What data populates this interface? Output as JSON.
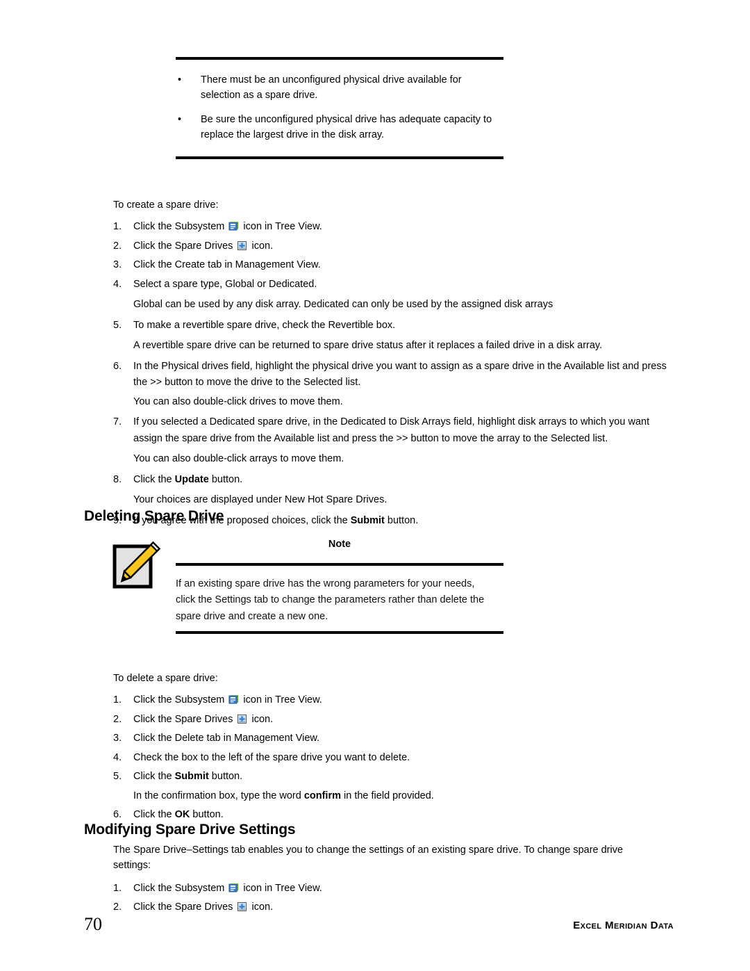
{
  "document": {
    "page_number": "70",
    "publisher": "Excel Meridian Data"
  },
  "top_callout": {
    "bullets": [
      "There must be an unconfigured physical drive available for selection as a spare drive.",
      "Be sure the unconfigured physical drive has adequate capacity to replace the largest drive in the disk array."
    ],
    "bullet_mark": "•"
  },
  "create_procedure": {
    "intro": "To create a spare drive:",
    "steps": [
      {
        "num": "1.",
        "pre": "Click the Subsystem ",
        "icon": "subsystem-icon",
        "post": " icon in Tree View."
      },
      {
        "num": "2.",
        "pre": "Click the Spare Drives ",
        "icon": "spare-drives-icon",
        "post": " icon."
      },
      {
        "num": "3.",
        "pre": "Click the Create tab in Management View.",
        "icon": null,
        "post": ""
      },
      {
        "num": "4.",
        "pre": "Select a spare type, Global or Dedicated.",
        "icon": null,
        "post": ""
      }
    ],
    "note_after_4": "Global can be used by any disk array. Dedicated can only be used by the assigned disk arrays",
    "step5": {
      "num": "5.",
      "text": "To make a revertible spare drive, check the Revertible box."
    },
    "note_after_5": "A revertible spare drive can be returned to spare drive status after it replaces a failed drive in a disk array.",
    "step6": {
      "num": "6.",
      "text": "In the Physical drives field, highlight the physical drive you want to assign as a spare drive in the Available list and press the >> button to move the drive to the Selected list."
    },
    "note_after_6": "You can also double-click drives to move them.",
    "step7": {
      "num": "7.",
      "text": "If you selected a Dedicated spare drive, in the Dedicated to Disk Arrays field, highlight disk arrays to which you want assign the spare drive from the Available list and press the >> button to move the array to the Selected list."
    },
    "note_after_7": "You can also double-click arrays to move them.",
    "step8": {
      "num": "8.",
      "pre": "Click the ",
      "bold": "Update",
      "post": " button."
    },
    "note_after_8": "Your choices are displayed under New Hot Spare Drives.",
    "step9": {
      "num": "9.",
      "pre": "If you agree with the proposed choices, click the ",
      "bold": "Submit",
      "post": " button."
    }
  },
  "deleting_section": {
    "heading": "Deleting Spare Drive",
    "note": {
      "label": "Note",
      "icon": "note-pencil-icon",
      "text": "If an existing spare drive has the wrong parameters for your needs, click the Settings tab to change the parameters rather than delete the spare drive and create a new one."
    },
    "intro": "To delete a spare drive:",
    "steps": [
      {
        "num": "1.",
        "pre": "Click the Subsystem ",
        "icon": "subsystem-icon",
        "post": " icon in Tree View."
      },
      {
        "num": "2.",
        "pre": "Click the Spare Drives ",
        "icon": "spare-drives-icon",
        "post": " icon."
      },
      {
        "num": "3.",
        "pre": "Click the Delete tab in Management View.",
        "icon": null,
        "post": ""
      },
      {
        "num": "4.",
        "pre": "Check the box to the left of the spare drive you want to delete.",
        "icon": null,
        "post": ""
      }
    ],
    "step5": {
      "num": "5.",
      "pre": "Click the ",
      "bold": "Submit",
      "post": " button."
    },
    "note_after_5_pre": "In the confirmation box, type the word ",
    "note_after_5_bold": "confirm",
    "note_after_5_post": " in the field provided.",
    "step6": {
      "num": "6.",
      "pre": "Click the ",
      "bold": "OK",
      "post": " button."
    }
  },
  "modifying_section": {
    "heading": "Modifying Spare Drive Settings",
    "intro": "The Spare Drive–Settings tab enables you to change the settings of an existing spare drive. To change spare drive settings:",
    "steps": [
      {
        "num": "1.",
        "pre": "Click the Subsystem ",
        "icon": "subsystem-icon",
        "post": " icon in Tree View."
      },
      {
        "num": "2.",
        "pre": "Click the Spare Drives ",
        "icon": "spare-drives-icon",
        "post": " icon."
      }
    ]
  },
  "colors": {
    "rule": "#000000",
    "icon_blue": "#3a7fd5",
    "icon_green": "#4f9b2e",
    "pencil_yellow": "#f5c518",
    "note_paper": "#e3e3e3"
  }
}
